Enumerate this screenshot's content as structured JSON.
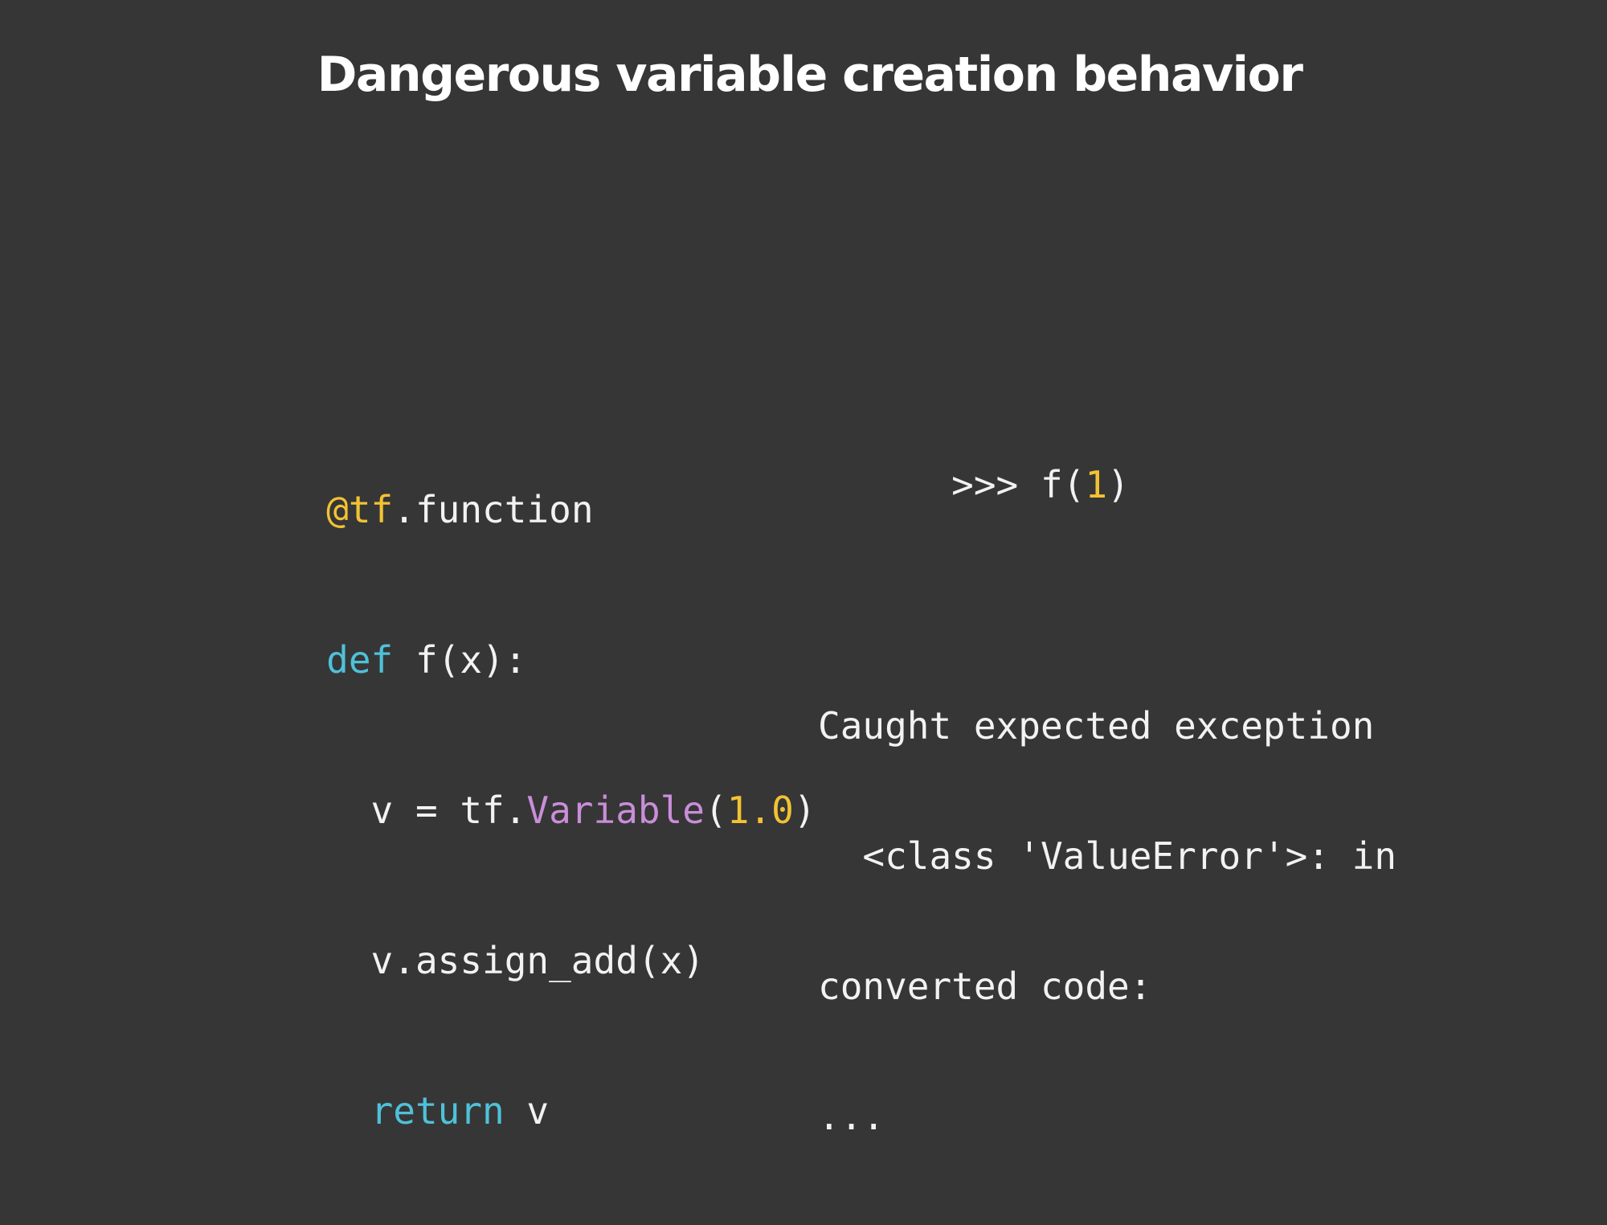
{
  "slide": {
    "title": "Dangerous variable creation behavior"
  },
  "code_left": {
    "lines": [
      {
        "tokens": [
          {
            "text": "@tf",
            "kind": "decorator"
          },
          {
            "text": ".function",
            "kind": "plain"
          }
        ]
      },
      {
        "tokens": [
          {
            "text": "def",
            "kind": "keyword"
          },
          {
            "text": " f(x):",
            "kind": "plain"
          }
        ]
      },
      {
        "tokens": [
          {
            "text": "  v = tf.",
            "kind": "plain"
          },
          {
            "text": "Variable",
            "kind": "class"
          },
          {
            "text": "(",
            "kind": "plain"
          },
          {
            "text": "1.0",
            "kind": "number"
          },
          {
            "text": ")",
            "kind": "plain"
          }
        ]
      },
      {
        "tokens": [
          {
            "text": "  v.assign_add(x)",
            "kind": "plain"
          }
        ]
      },
      {
        "tokens": [
          {
            "text": "  ",
            "kind": "plain"
          },
          {
            "text": "return",
            "kind": "keyword"
          },
          {
            "text": " v",
            "kind": "plain"
          }
        ]
      }
    ]
  },
  "code_right": {
    "prompt": {
      "tokens": [
        {
          "text": ">>> f(",
          "kind": "plain"
        },
        {
          "text": "1",
          "kind": "number"
        },
        {
          "text": ")",
          "kind": "plain"
        }
      ]
    },
    "output_lines": [
      "Caught expected exception",
      "  <class 'ValueError'>: in",
      "converted code:",
      "..."
    ]
  },
  "colors": {
    "background": "#363636",
    "title": "#ffffff",
    "code_plain": "#f2f2f2",
    "decorator": "#f2c233",
    "keyword": "#4fc1d9",
    "class": "#c98ed9",
    "number": "#f2c233"
  }
}
